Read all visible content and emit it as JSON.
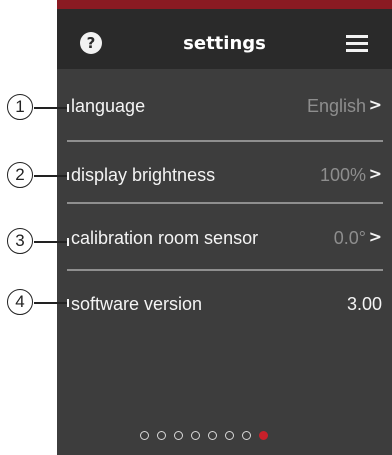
{
  "header": {
    "title": "settings",
    "help_glyph": "?",
    "help_icon": "question-circle-icon",
    "menu_icon": "hamburger-menu-icon"
  },
  "callouts": [
    "1",
    "2",
    "3",
    "4"
  ],
  "settings": [
    {
      "label": "language",
      "value": "English",
      "chevron": ">"
    },
    {
      "label": "display brightness",
      "value": "100%",
      "chevron": ">"
    },
    {
      "label": "calibration room sensor",
      "value": "0.0°",
      "chevron": ">"
    },
    {
      "label": "software version",
      "value": "3.00"
    }
  ],
  "pager": {
    "count": 8,
    "active_index": 7
  },
  "colors": {
    "background": "#3d3d3d",
    "header": "#2a2a2a",
    "top_strip": "#8a1a22",
    "text": "#f4f4f4",
    "muted_value": "#8e8e8e",
    "active_dot": "#c8202a"
  }
}
